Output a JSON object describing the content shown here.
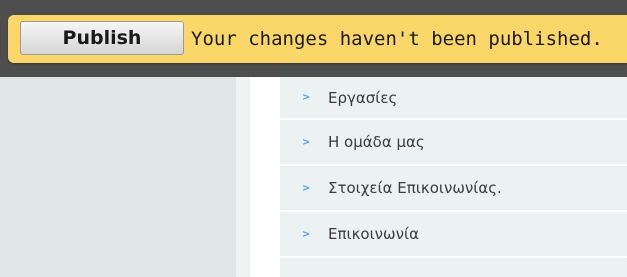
{
  "publish_bar": {
    "button_label": "Publish",
    "message": "Your changes haven't been published."
  },
  "menu": {
    "arrow_icon": "chevron-right-icon",
    "items": [
      {
        "label": "Εργασίες"
      },
      {
        "label": "Η ομάδα μας"
      },
      {
        "label": "Στοιχεία Επικοινωνίας."
      },
      {
        "label": "Επικοινωνία"
      }
    ]
  },
  "colors": {
    "bar_background": "#4e4e4e",
    "banner_yellow": "#fbd769",
    "menu_background": "#ecf1f2",
    "arrow_blue": "#48a0e8"
  }
}
